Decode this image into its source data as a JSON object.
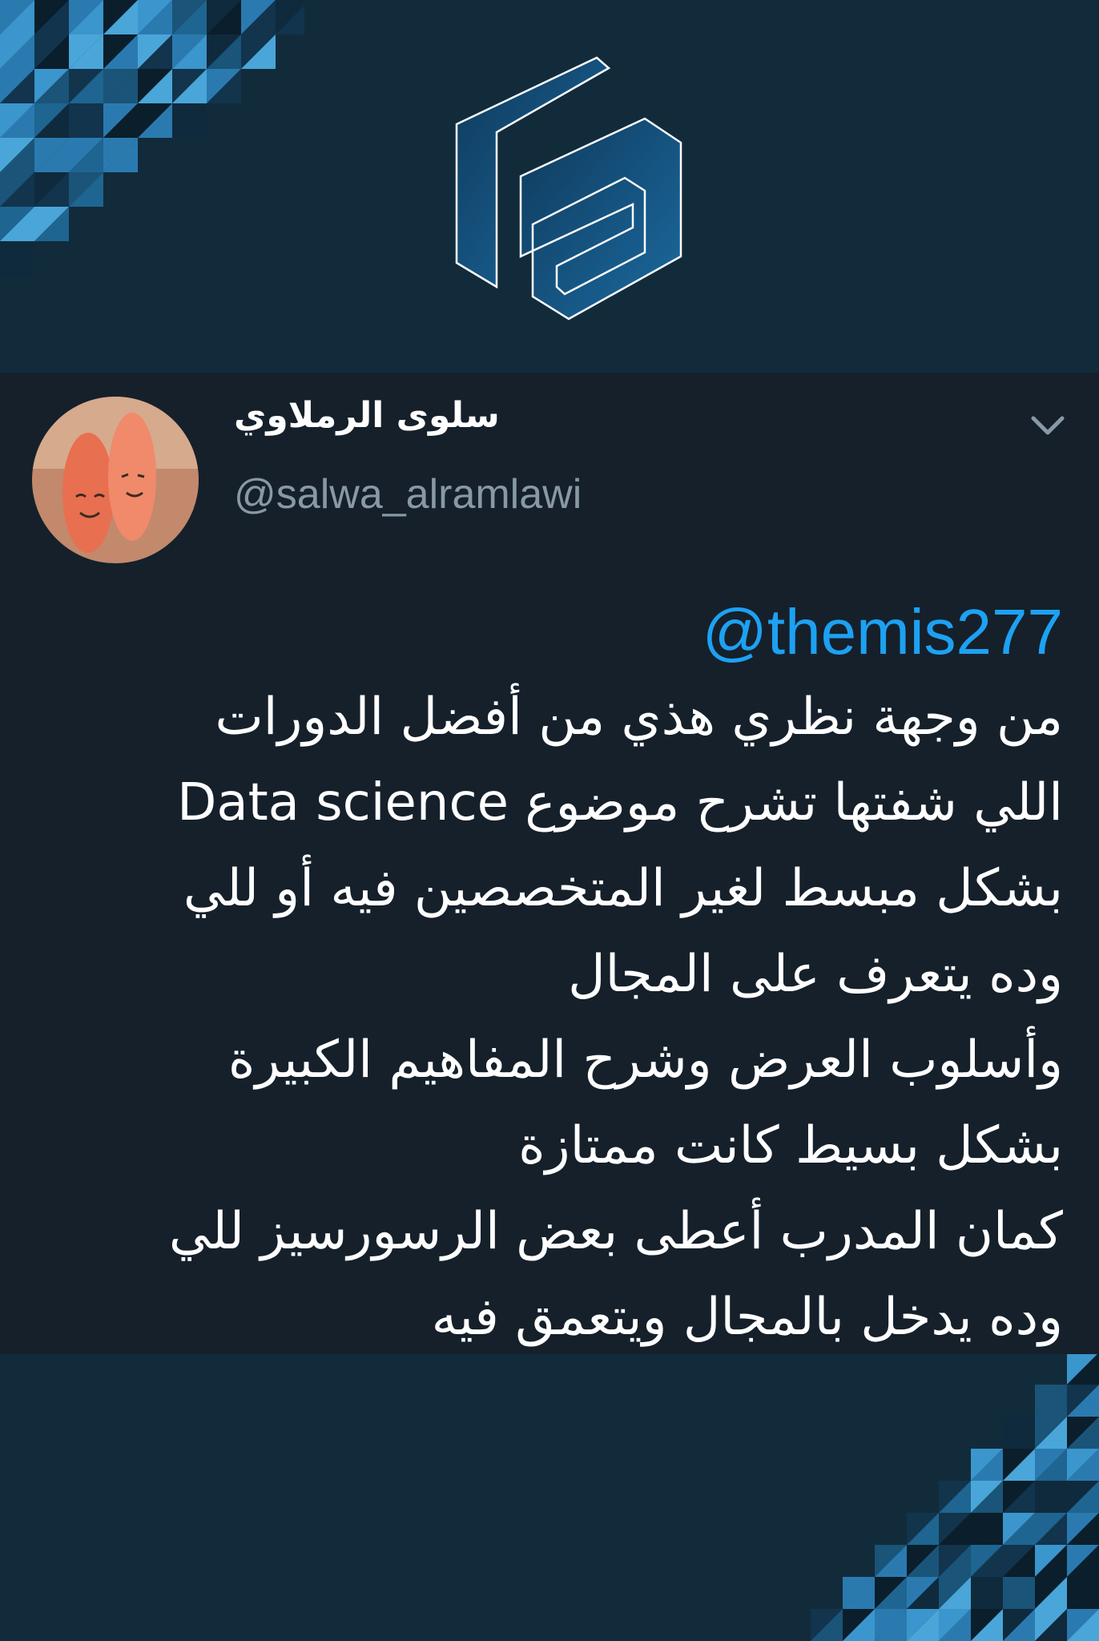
{
  "tweet": {
    "display_name": "سلوى الرملاوي",
    "handle": "@salwa_alramlawi",
    "mention": "@themis277",
    "lines": [
      "من وجهة نظري هذي من أفضل الدورات",
      "اللي شفتها تشرح موضوع Data science",
      "بشكل مبسط لغير المتخصصين فيه أو للي",
      "وده يتعرف على المجال",
      "وأسلوب العرض وشرح المفاهيم الكبيرة",
      "بشكل بسيط كانت ممتازة",
      "كمان المدرب أعطى بعض الرسورسيز للي",
      "وده يدخل بالمجال ويتعمق فيه"
    ]
  },
  "icons": {
    "logo": "brand-logo",
    "avatar": "avatar",
    "menu": "chevron-down-icon"
  },
  "colors": {
    "background": "#122b3b",
    "card": "#15202b",
    "mention": "#1da1f2",
    "handle": "#8899a6"
  }
}
